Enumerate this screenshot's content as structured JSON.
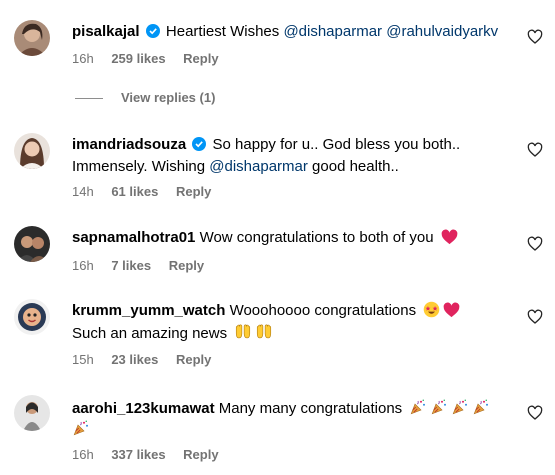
{
  "comments": [
    {
      "username": "pisalkajal",
      "verified": true,
      "text_parts": [
        "Heartiest Wishes ",
        "@dishaparmar",
        " ",
        "@rahulvaidyarkv"
      ],
      "time": "16h",
      "likes": "259 likes",
      "reply": "Reply",
      "view_replies": "View replies (1)"
    },
    {
      "username": "imandriadsouza",
      "verified": true,
      "line1": "So happy for u.. God bless you both..",
      "line2_pre": "Immensely. Wishing ",
      "line2_mention": "@dishaparmar",
      "line2_post": " good health..",
      "time": "14h",
      "likes": "61 likes",
      "reply": "Reply"
    },
    {
      "username": "sapnamalhotra01",
      "text": "Wow congratulations to both of you",
      "emoji": "red-heart",
      "time": "16h",
      "likes": "7 likes",
      "reply": "Reply"
    },
    {
      "username": "krumm_yumm_watch",
      "line1": "Wooohoooo congratulations",
      "line2": "Such an amazing news",
      "emoji_line1": [
        "star-struck-face",
        "red-heart"
      ],
      "emoji_line2": [
        "raising-hands",
        "raising-hands"
      ],
      "time": "15h",
      "likes": "23 likes",
      "reply": "Reply"
    },
    {
      "username": "aarohi_123kumawat",
      "text": "Many many congratulations",
      "emoji": [
        "party-popper",
        "party-popper",
        "party-popper",
        "party-popper",
        "party-popper"
      ],
      "time": "16h",
      "likes": "337 likes",
      "reply": "Reply"
    }
  ],
  "colors": {
    "mention": "#00376b",
    "meta": "#737373",
    "verified": "#0095f6",
    "heart_emoji": "#e0245e"
  },
  "icons": {
    "like_button": "heart-outline-icon",
    "verified_badge": "verified-badge-icon"
  }
}
